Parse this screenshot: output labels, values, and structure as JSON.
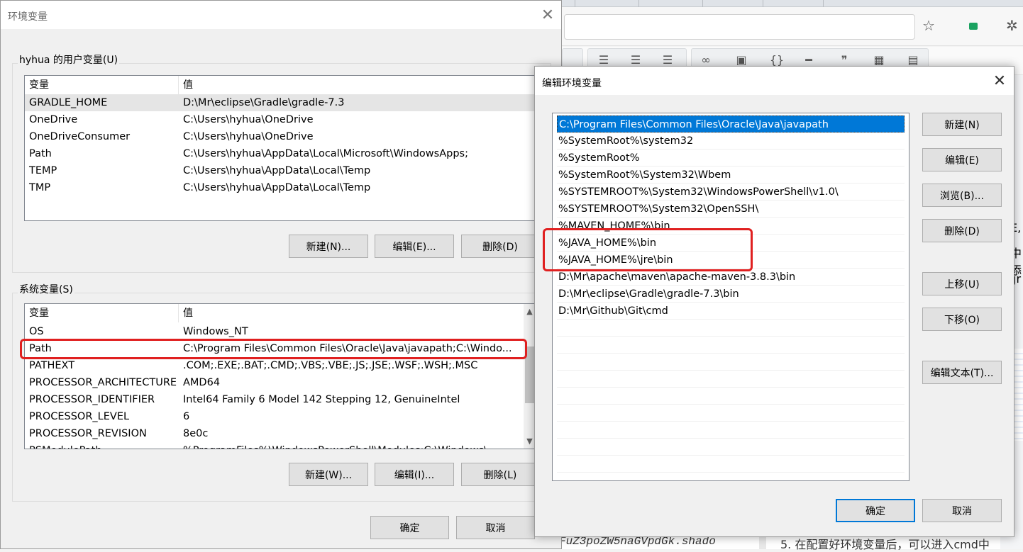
{
  "background": {
    "bottom_code_text": "FuZ3poZW5naGVpdGk.shado",
    "bottom_text": "5.  在配置好环境变量后，可以进入cmd中",
    "right_fragments": [
      "E,",
      "中添",
      "jr"
    ]
  },
  "env_window": {
    "title": "环境变量",
    "user_group_label": "hyhua 的用户变量(U)",
    "columns": {
      "var": "变量",
      "val": "值"
    },
    "user_vars": [
      {
        "name": "GRADLE_HOME",
        "value": "D:\\Mr\\eclipse\\Gradle\\gradle-7.3"
      },
      {
        "name": "OneDrive",
        "value": "C:\\Users\\hyhua\\OneDrive"
      },
      {
        "name": "OneDriveConsumer",
        "value": "C:\\Users\\hyhua\\OneDrive"
      },
      {
        "name": "Path",
        "value": "C:\\Users\\hyhua\\AppData\\Local\\Microsoft\\WindowsApps;"
      },
      {
        "name": "TEMP",
        "value": "C:\\Users\\hyhua\\AppData\\Local\\Temp"
      },
      {
        "name": "TMP",
        "value": "C:\\Users\\hyhua\\AppData\\Local\\Temp"
      }
    ],
    "user_buttons": {
      "new": "新建(N)...",
      "edit": "编辑(E)...",
      "delete": "删除(D)"
    },
    "system_group_label": "系统变量(S)",
    "system_vars": [
      {
        "name": "OS",
        "value": "Windows_NT"
      },
      {
        "name": "Path",
        "value": "C:\\Program Files\\Common Files\\Oracle\\Java\\javapath;C:\\Windo..."
      },
      {
        "name": "PATHEXT",
        "value": ".COM;.EXE;.BAT;.CMD;.VBS;.VBE;.JS;.JSE;.WSF;.WSH;.MSC"
      },
      {
        "name": "PROCESSOR_ARCHITECTURE",
        "value": "AMD64"
      },
      {
        "name": "PROCESSOR_IDENTIFIER",
        "value": "Intel64 Family 6 Model 142 Stepping 12, GenuineIntel"
      },
      {
        "name": "PROCESSOR_LEVEL",
        "value": "6"
      },
      {
        "name": "PROCESSOR_REVISION",
        "value": "8e0c"
      },
      {
        "name": "PSModulePath",
        "value": "%ProgramFiles%\\WindowsPowerShell\\Modules;C:\\Windows\\..."
      }
    ],
    "system_buttons": {
      "new": "新建(W)...",
      "edit": "编辑(I)...",
      "delete": "删除(L)"
    },
    "ok": "确定",
    "cancel": "取消"
  },
  "edit_window": {
    "title": "编辑环境变量",
    "paths": [
      "C:\\Program Files\\Common Files\\Oracle\\Java\\javapath",
      "%SystemRoot%\\system32",
      "%SystemRoot%",
      "%SystemRoot%\\System32\\Wbem",
      "%SYSTEMROOT%\\System32\\WindowsPowerShell\\v1.0\\",
      "%SYSTEMROOT%\\System32\\OpenSSH\\",
      "%MAVEN_HOME%\\bin",
      "%JAVA_HOME%\\bin",
      "%JAVA_HOME%\\jre\\bin",
      "D:\\Mr\\apache\\maven\\apache-maven-3.8.3\\bin",
      "D:\\Mr\\eclipse\\Gradle\\gradle-7.3\\bin",
      "D:\\Mr\\Github\\Git\\cmd"
    ],
    "buttons": {
      "new": "新建(N)",
      "edit": "编辑(E)",
      "browse": "浏览(B)...",
      "delete": "删除(D)",
      "up": "上移(U)",
      "down": "下移(O)",
      "edit_text": "编辑文本(T)..."
    },
    "ok": "确定",
    "cancel": "取消"
  },
  "colors": {
    "highlight_red": "#e02020",
    "selection_blue": "#0078d7"
  }
}
